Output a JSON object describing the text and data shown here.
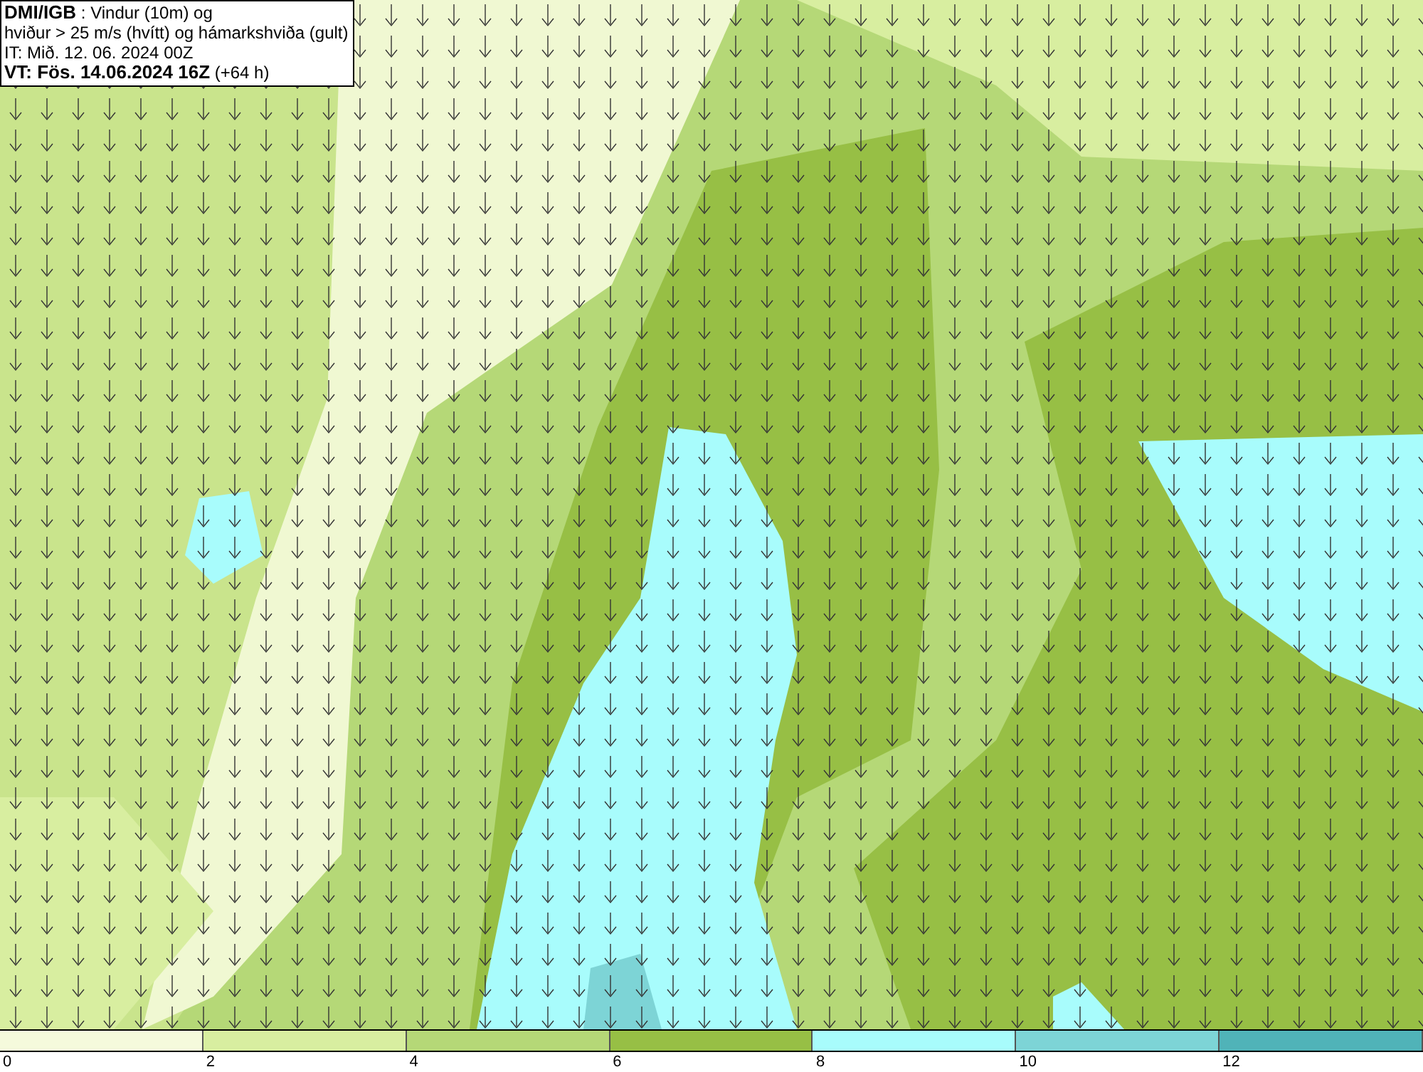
{
  "title_box": {
    "lines": [
      "**DMI/IGB** : Vindur (10m) og",
      "hviður > 25 m/s (hvítt) og hámarkshviða (gult)",
      "IT: Mið. 12. 06. 2024 00Z",
      "**VT: Fös. 14.06.2024 16Z** (+64 h)"
    ]
  },
  "legend": {
    "bins": [
      {
        "color": "#f5fadc"
      },
      {
        "color": "#d8eea0"
      },
      {
        "color": "#b5d877"
      },
      {
        "color": "#97bf45"
      },
      {
        "color": "#a8fcfc"
      },
      {
        "color": "#7dd4d6"
      },
      {
        "color": "#50b3b8"
      }
    ],
    "labels": [
      "0",
      "2",
      "4",
      "6",
      "8",
      "10",
      "12"
    ]
  }
}
